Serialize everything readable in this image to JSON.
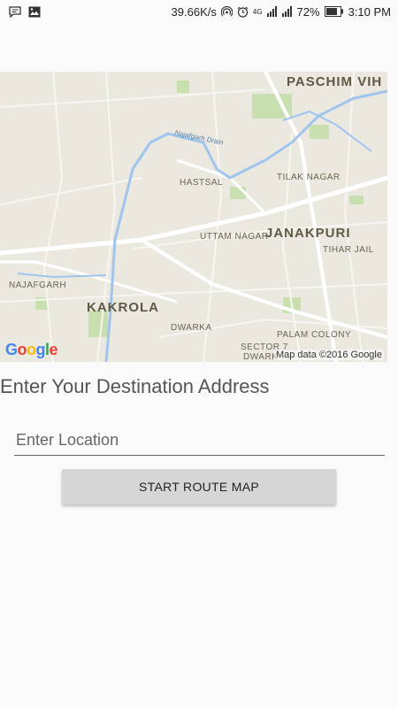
{
  "status_bar": {
    "left_icons": [
      "chat-notification-icon",
      "image-notification-icon"
    ],
    "network_speed": "39.66K/s",
    "network_type": "4G",
    "battery": "72%",
    "time": "3:10 PM"
  },
  "map": {
    "labels": {
      "paschim_vih": "PASCHIM VIH",
      "najafgarh_drain": "Najafgarh Drain",
      "hastsal": "HASTSAL",
      "tilak_nagar": "TILAK NAGAR",
      "uttam_nagar": "UTTAM NAGAR",
      "janakpuri": "JANAKPURI",
      "tihar_jail": "TIHAR JAIL",
      "najafgarh": "NAJAFGARH",
      "kakrola": "KAKROLA",
      "dwarka": "DWARKA",
      "palam_colony": "PALAM COLONY",
      "sector7": "SECTOR 7",
      "dwark": "DWARK"
    },
    "logo": [
      "G",
      "o",
      "o",
      "g",
      "l",
      "e"
    ],
    "logo_colors": [
      "#4285f4",
      "#ea4335",
      "#fbbc05",
      "#4285f4",
      "#34a853",
      "#ea4335"
    ],
    "attribution": "Map data ©2016 Google"
  },
  "form": {
    "title": "Enter Your Destination Address",
    "location_placeholder": "Enter Location",
    "location_value": "",
    "start_button": "START ROUTE  MAP"
  }
}
